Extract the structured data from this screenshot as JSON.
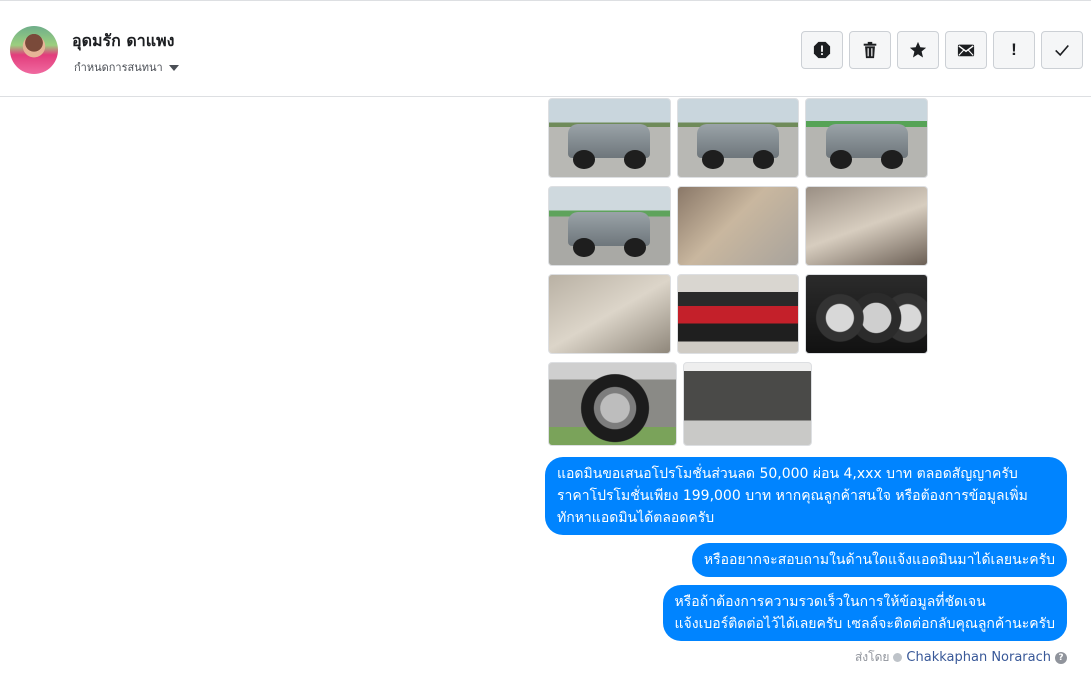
{
  "contact": {
    "name": "อุดมรัก ดาแพง",
    "settings_label": "กำหนดการสนทนา"
  },
  "actions": [
    {
      "icon": "alert-circle-icon"
    },
    {
      "icon": "trash-icon"
    },
    {
      "icon": "star-icon"
    },
    {
      "icon": "envelope-icon"
    },
    {
      "icon": "exclamation-icon",
      "glyph": "!"
    },
    {
      "icon": "checkmark-icon"
    }
  ],
  "gallery": {
    "images": [
      "truck-rear-view",
      "truck-rear-view-2",
      "truck-front-view",
      "truck-front-side-view",
      "door-panel",
      "dashboard-steering",
      "front-seats",
      "red-black-seats",
      "gauge-cluster",
      "alloy-wheel",
      "engine-bay"
    ]
  },
  "messages": [
    {
      "text": "แอดมินขอเสนอโปรโมชั่นส่วนลด 50,000 ผ่อน 4,xxx บาท ตลอดสัญญาครับ\nราคาโปรโมชั่นเพียง 199,000 บาท หากคุณลูกค้าสนใจ หรือต้องการข้อมูลเพิ่ม\nทักหาแอดมินได้ตลอดครับ"
    },
    {
      "text": "หรืออยากจะสอบถามในด้านใดแจ้งแอดมินมาได้เลยนะครับ"
    },
    {
      "text": "หรือถ้าต้องการความรวดเร็วในการให้ข้อมูลที่ชัดเจน\nแจ้งเบอร์ติดต่อไว้ได้เลยครับ เซลล์จะติดต่อกลับคุณลูกค้านะครับ"
    }
  ],
  "sent_by": {
    "prefix": "ส่งโดย",
    "agent": "Chakkaphan Norarach",
    "help": "?"
  },
  "colors": {
    "bubble": "#0084ff",
    "agent_link": "#385898"
  }
}
